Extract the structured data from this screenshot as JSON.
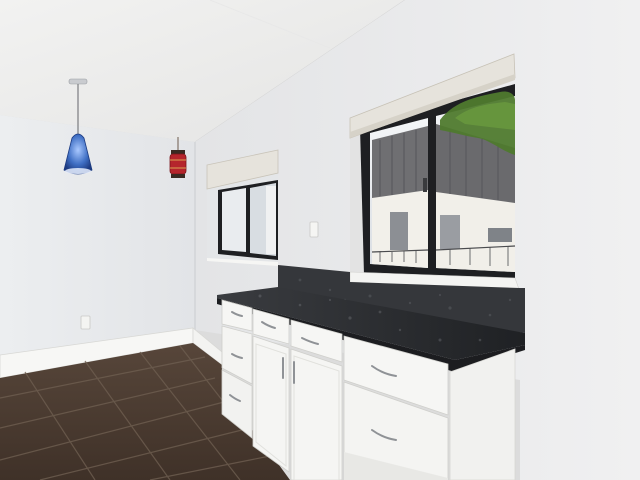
{
  "scene": {
    "kind": "interior-photo",
    "subject": "kitchen-corner",
    "colors": {
      "ceiling": "#f3f3f2",
      "left_wall": "#e9eaec",
      "right_wall": "#ececed",
      "floor": "#4f3e32",
      "floor_grout": "#6e5e50",
      "countertop": "#2a2c30",
      "backsplash": "#35373b",
      "cabinet": "#f6f6f4",
      "cabinet_shadow": "#dcdcd8",
      "window_frame": "#1e1f22",
      "blind": "#e6e3dc",
      "baseboard": "#f7f7f5",
      "pendant_glass": "#3f6fc4",
      "lantern": "#b5252c",
      "tree": "#4f7a2e",
      "building": "#6f6f72",
      "sky": "#e8edf2"
    },
    "objects": {
      "pendant_light": "blue-glass-pendant",
      "lantern": "red-hanging-lantern",
      "small_window": "small-window",
      "large_window": "large-window",
      "countertop": "granite-countertop",
      "cabinets": "white-cabinets",
      "floor": "tile-floor",
      "outlet": "wall-outlet",
      "switch": "light-switch"
    }
  }
}
